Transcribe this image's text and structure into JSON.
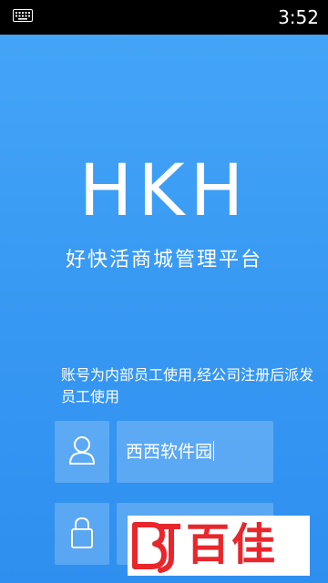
{
  "status_bar": {
    "time": "3:52",
    "left_icon": "keyboard-icon"
  },
  "app": {
    "logo": "HKH",
    "subtitle": "好快活商城管理平台"
  },
  "notice": "账号为内部员工使用,经公司注册后派发员工使用",
  "username": {
    "icon": "user-icon",
    "value": "西西软件园"
  },
  "password": {
    "icon": "lock-icon",
    "value": ""
  },
  "watermark": {
    "text": "百佳",
    "colors": {
      "primary": "#e8262c"
    }
  },
  "colors": {
    "background_top": "#45a6f7",
    "background_bottom": "#2f8ff0",
    "status_bar": "#000000"
  }
}
